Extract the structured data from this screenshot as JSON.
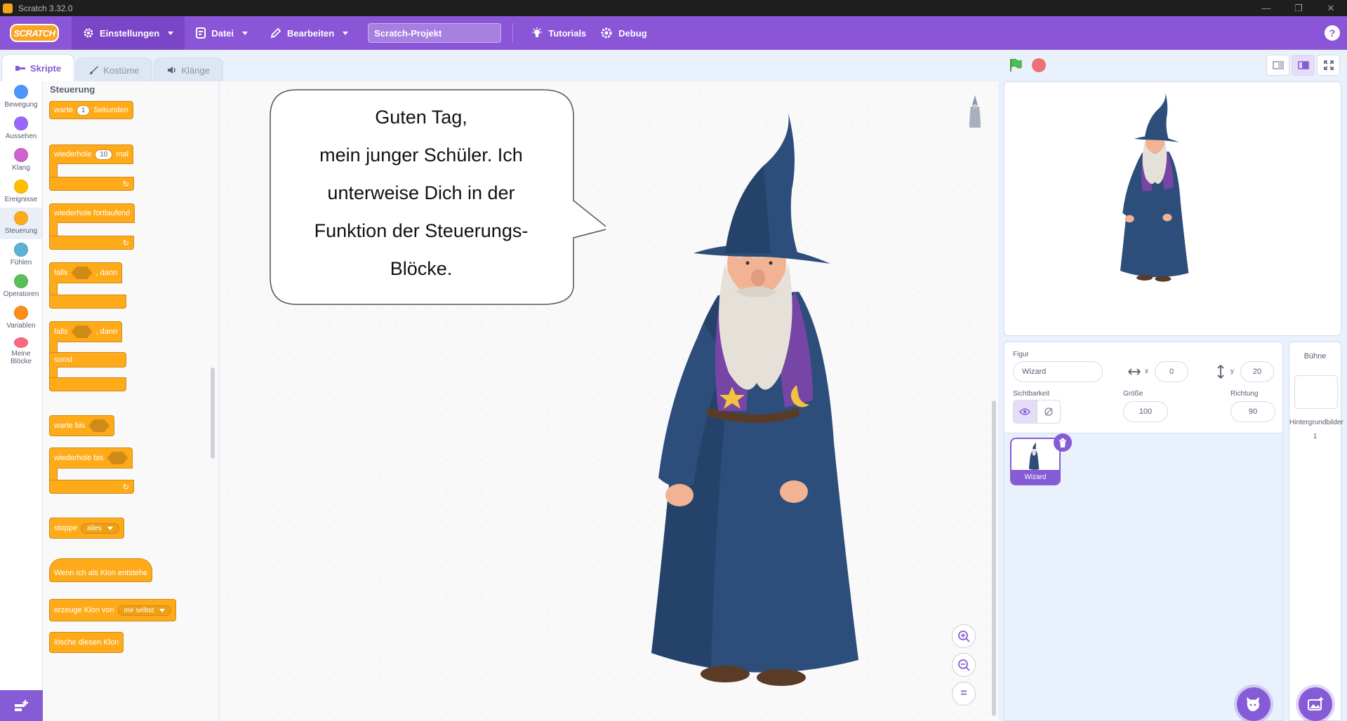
{
  "window": {
    "title": "Scratch 3.32.0",
    "controls": [
      "—",
      "❐",
      "✕"
    ]
  },
  "menubar": {
    "logo": "SCRATCH",
    "settings": "Einstellungen",
    "file": "Datei",
    "edit": "Bearbeiten",
    "project_title": "Scratch-Projekt",
    "tutorials": "Tutorials",
    "debug": "Debug",
    "help": "?"
  },
  "tabs": {
    "code": "Skripte",
    "costumes": "Kostüme",
    "sounds": "Klänge"
  },
  "categories": [
    {
      "label": "Bewegung",
      "color": "#4c97ff"
    },
    {
      "label": "Aussehen",
      "color": "#9966ff"
    },
    {
      "label": "Klang",
      "color": "#cf63cf"
    },
    {
      "label": "Ereignisse",
      "color": "#ffbf00"
    },
    {
      "label": "Steuerung",
      "color": "#ffab19"
    },
    {
      "label": "Fühlen",
      "color": "#5cb1d6"
    },
    {
      "label": "Operatoren",
      "color": "#59c059"
    },
    {
      "label": "Variablen",
      "color": "#ff8c1a"
    },
    {
      "label": "Meine Blöcke",
      "color": "#ff6680"
    }
  ],
  "palette": {
    "title": "Steuerung",
    "wait": {
      "pre": "warte",
      "value": "1",
      "post": "Sekunden"
    },
    "repeat": {
      "pre": "wiederhole",
      "value": "10",
      "post": "mal"
    },
    "forever": "wiederhole fortlaufend",
    "if_then": {
      "pre": "falls",
      "post": ", dann"
    },
    "if_else": {
      "pre": "falls",
      "post": ", dann",
      "else": "sonst"
    },
    "wait_until": "warte bis",
    "repeat_until": "wiederhole bis",
    "stop": {
      "pre": "stoppe",
      "option": "alles"
    },
    "clone_hat": "Wenn ich als Klon entstehe",
    "create_clone": {
      "pre": "erzeuge Klon von",
      "option": "mir selbst"
    },
    "delete_clone": "lösche diesen Klon",
    "loop_arrow": "↻"
  },
  "speech_bubble": {
    "line1": "Guten Tag,",
    "line2": "mein junger Schüler. Ich",
    "line3": "unterweise Dich in der",
    "line4": "Funktion der Steuerungs-",
    "line5": "Blöcke."
  },
  "zoom": {
    "in": "+",
    "out": "−",
    "reset": "="
  },
  "sprite_info": {
    "sprite_label": "Figur",
    "sprite_name": "Wizard",
    "x_label": "x",
    "x_value": "0",
    "y_label": "y",
    "y_value": "20",
    "visibility_label": "Sichtbarkeit",
    "size_label": "Größe",
    "size_value": "100",
    "direction_label": "Richtung",
    "direction_value": "90"
  },
  "sprite_list": [
    {
      "name": "Wizard"
    }
  ],
  "stage_selector": {
    "title": "Bühne",
    "backdrops_label": "Hintergrundbilder",
    "backdrops_count": "1"
  },
  "colors": {
    "menu": "#8a55d6",
    "control_block": "#ffab19",
    "accent": "#855cd6"
  }
}
